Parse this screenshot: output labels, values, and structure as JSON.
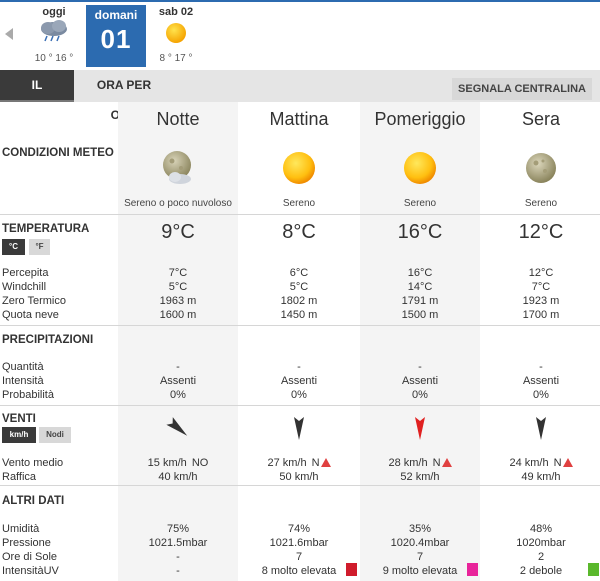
{
  "days": [
    {
      "name": "oggi",
      "temps": "10 ° 16 °",
      "icon": "rain-cloud-icon"
    },
    {
      "name": "domani",
      "number": "01",
      "selected": true
    },
    {
      "name": "sab 02",
      "temps": "8 ° 17 °",
      "icon": "sun-icon"
    }
  ],
  "tabs": {
    "giorno": "IL GIORNO",
    "ora": "ORA PER ORA"
  },
  "segnala": "SEGNALA CENTRALINA",
  "sections": {
    "condizioni": "CONDIZIONI METEO",
    "temperatura": "TEMPERATURA",
    "precipitazioni": "PRECIPITAZIONI",
    "venti": "VENTI",
    "altri": "ALTRI DATI"
  },
  "units": {
    "celsius": "°C",
    "fahrenheit": "°F",
    "kmh": "km/h",
    "nodi": "Nodi"
  },
  "labels": {
    "percepita": "Percepita",
    "windchill": "Windchill",
    "zero_termico": "Zero Termico",
    "quota_neve": "Quota neve",
    "quantita": "Quantità",
    "intensita": "Intensità",
    "probabilita": "Probabilità",
    "vento_medio": "Vento medio",
    "raffica": "Raffica",
    "umidita": "Umidità",
    "pressione": "Pressione",
    "ore_sole": "Ore di Sole",
    "intensita_uv": "IntensitàUV"
  },
  "periods": [
    {
      "name": "Notte",
      "icon": "moon-cloud-icon",
      "condition": "Sereno o poco nuvoloso",
      "temp": "9°C",
      "percepita": "7°C",
      "windchill": "5°C",
      "zero_termico": "1963 m",
      "quota_neve": "1600 m",
      "quantita": "-",
      "intensita": "Assenti",
      "probabilita": "0%",
      "wind_dir": "NO",
      "wind_warning": false,
      "wind_arrow_deg": -50,
      "wind_color": "#333333",
      "vento_medio": "15 km/h",
      "raffica": "40 km/h",
      "umidita": "75%",
      "pressione": "1021.5mbar",
      "ore_sole": "-",
      "uv": "-",
      "uv_color": ""
    },
    {
      "name": "Mattina",
      "icon": "sun-icon",
      "condition": "Sereno",
      "temp": "8°C",
      "percepita": "6°C",
      "windchill": "5°C",
      "zero_termico": "1802 m",
      "quota_neve": "1450 m",
      "quantita": "-",
      "intensita": "Assenti",
      "probabilita": "0%",
      "wind_dir": "N",
      "wind_warning": true,
      "wind_arrow_deg": 0,
      "wind_color": "#333333",
      "vento_medio": "27 km/h",
      "raffica": "50 km/h",
      "umidita": "74%",
      "pressione": "1021.6mbar",
      "ore_sole": "7",
      "uv": "8 molto elevata",
      "uv_color": "#d01c2c"
    },
    {
      "name": "Pomeriggio",
      "icon": "sun-icon",
      "condition": "Sereno",
      "temp": "16°C",
      "percepita": "16°C",
      "windchill": "14°C",
      "zero_termico": "1791 m",
      "quota_neve": "1500 m",
      "quantita": "-",
      "intensita": "Assenti",
      "probabilita": "0%",
      "wind_dir": "N",
      "wind_warning": true,
      "wind_arrow_deg": 0,
      "wind_color": "#e02020",
      "vento_medio": "28 km/h",
      "raffica": "52 km/h",
      "umidita": "35%",
      "pressione": "1020.4mbar",
      "ore_sole": "7",
      "uv": "9 molto elevata",
      "uv_color": "#e8239a"
    },
    {
      "name": "Sera",
      "icon": "moon-icon",
      "condition": "Sereno",
      "temp": "12°C",
      "percepita": "12°C",
      "windchill": "7°C",
      "zero_termico": "1923 m",
      "quota_neve": "1700 m",
      "quantita": "-",
      "intensita": "Assenti",
      "probabilita": "0%",
      "wind_dir": "N",
      "wind_warning": true,
      "wind_arrow_deg": 0,
      "wind_color": "#333333",
      "vento_medio": "24 km/h",
      "raffica": "49 km/h",
      "umidita": "48%",
      "pressione": "1020mbar",
      "ore_sole": "2",
      "uv": "2 debole",
      "uv_color": "#5ab82c"
    }
  ]
}
